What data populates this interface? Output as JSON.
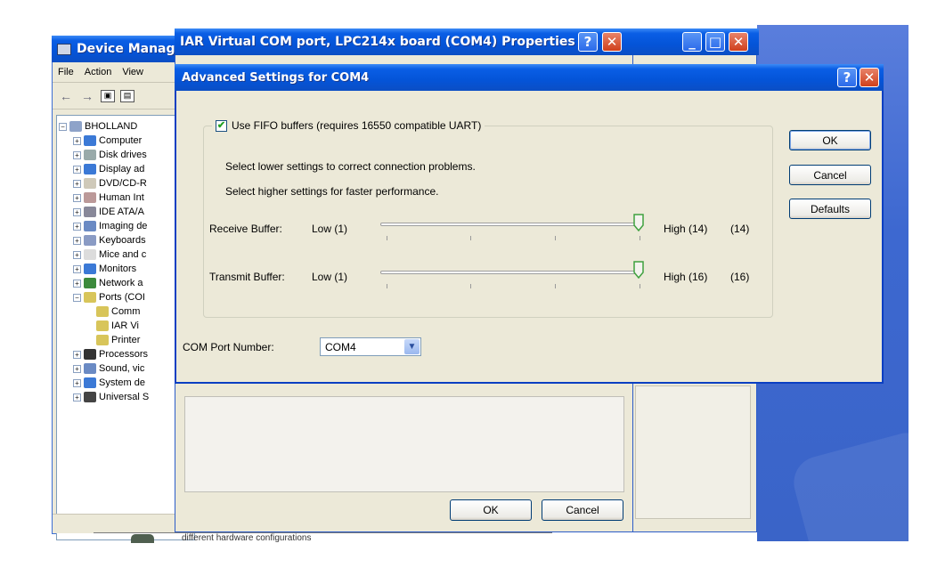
{
  "device_manager": {
    "title": "Device Manage",
    "menu": [
      "File",
      "Action",
      "View"
    ],
    "tree": {
      "root": "BHOLLAND",
      "items": [
        "Computer",
        "Disk drives",
        "Display ad",
        "DVD/CD-R",
        "Human Int",
        "IDE ATA/A",
        "Imaging de",
        "Keyboards",
        "Mice and c",
        "Monitors",
        "Network a",
        "Ports (COI"
      ],
      "ports_children": [
        "Comm",
        "IAR Vi",
        "Printer"
      ],
      "items_after": [
        "Processors",
        "Sound, vic",
        "System de",
        "Universal S"
      ]
    }
  },
  "properties": {
    "title": "IAR Virtual COM port, LPC214x board (COM4) Properties",
    "ok_label": "OK",
    "cancel_label": "Cancel",
    "below_text": "different hardware configurations"
  },
  "advanced": {
    "title": "Advanced Settings for COM4",
    "fifo_label": "Use FIFO buffers (requires 16550 compatible UART)",
    "fifo_checked": true,
    "hint_lower": "Select lower settings to correct connection problems.",
    "hint_higher": "Select higher settings for faster performance.",
    "receive": {
      "label": "Receive Buffer:",
      "low": "Low (1)",
      "high": "High (14)",
      "value": "(14)",
      "level": 1.0
    },
    "transmit": {
      "label": "Transmit Buffer:",
      "low": "Low (1)",
      "high": "High (16)",
      "value": "(16)",
      "level": 1.0
    },
    "com_port_label": "COM Port Number:",
    "com_port_value": "COM4",
    "buttons": {
      "ok": "OK",
      "cancel": "Cancel",
      "defaults": "Defaults"
    },
    "help_glyph": "?",
    "close_glyph": "✕"
  },
  "colors": {
    "titlebar": "#0454d8",
    "dialog_bg": "#ece9d8",
    "check": "#21a121"
  }
}
